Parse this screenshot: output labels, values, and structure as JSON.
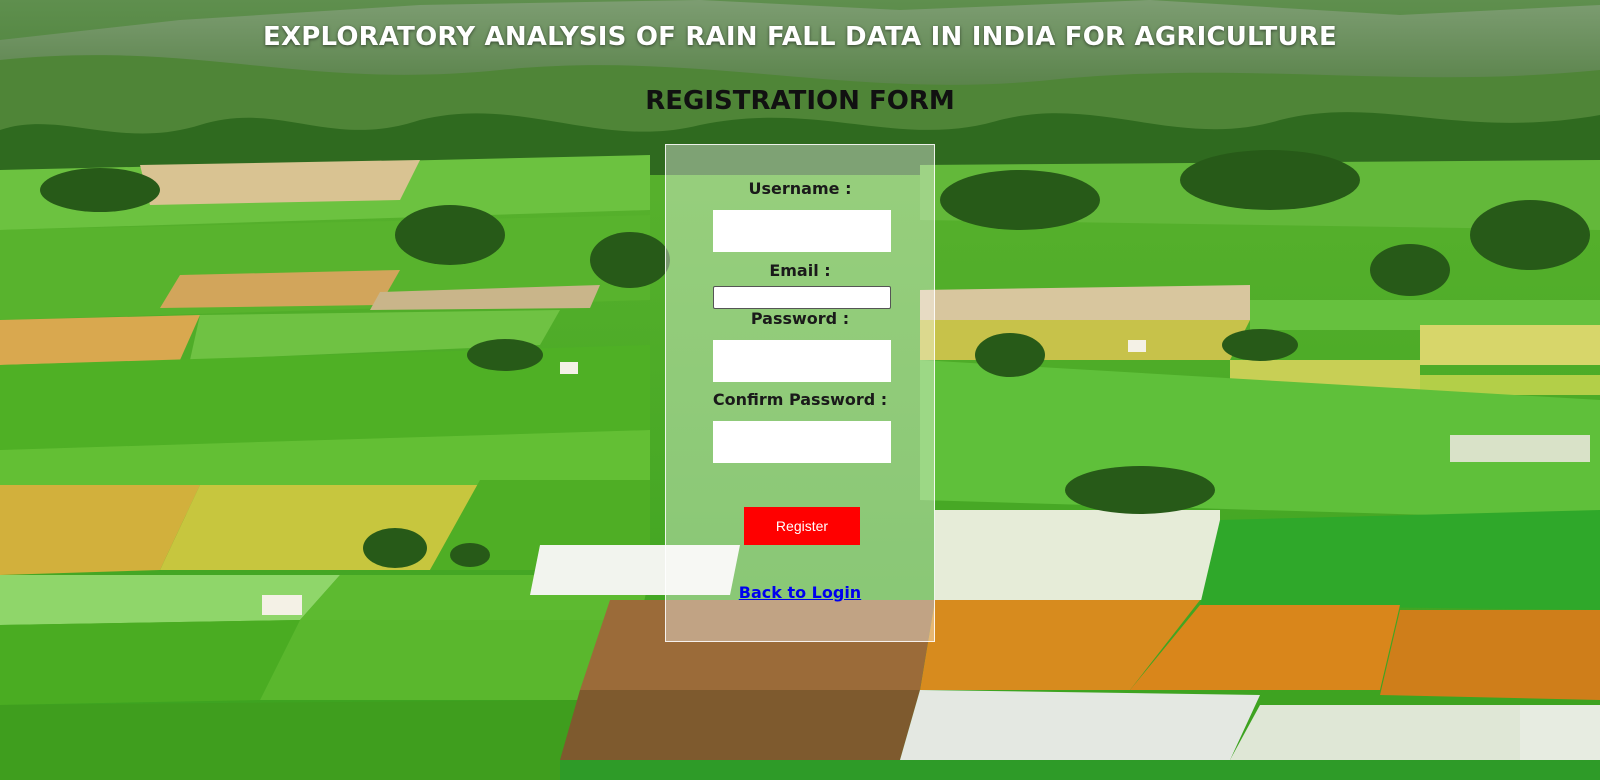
{
  "header": {
    "title": "EXPLORATORY ANALYSIS OF RAIN FALL DATA IN INDIA FOR AGRICULTURE",
    "form_title": "REGISTRATION FORM"
  },
  "form": {
    "username_label": "Username :",
    "username_value": "",
    "email_label": "Email :",
    "email_value": "",
    "password_label": "Password :",
    "password_value": "",
    "confirm_password_label": "Confirm Password :",
    "confirm_password_value": "",
    "register_label": "Register",
    "back_link_label": "Back to Login"
  },
  "colors": {
    "register_button": "#ff0000",
    "link": "#0000ee",
    "title_text": "#ffffff",
    "form_title_text": "#111111"
  }
}
